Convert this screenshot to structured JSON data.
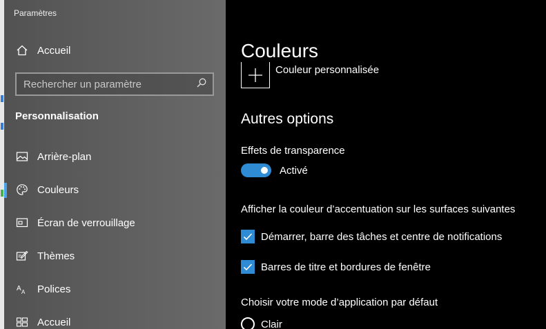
{
  "window": {
    "title": "Paramètres"
  },
  "sidebar": {
    "home_label": "Accueil",
    "search_placeholder": "Rechercher un paramètre",
    "section_title": "Personnalisation",
    "items": [
      {
        "label": "Arrière-plan",
        "icon": "image-icon"
      },
      {
        "label": "Couleurs",
        "icon": "palette-icon",
        "active": true
      },
      {
        "label": "Écran de verrouillage",
        "icon": "lock-screen-icon"
      },
      {
        "label": "Thèmes",
        "icon": "themes-icon"
      },
      {
        "label": "Polices",
        "icon": "font-icon"
      },
      {
        "label": "Accueil",
        "icon": "start-icon"
      }
    ],
    "accent_color": "#4aa3e8"
  },
  "main": {
    "title": "Couleurs",
    "custom_color_label": "Couleur personnalisée",
    "other_options_heading": "Autres options",
    "transparency": {
      "label": "Effets de transparence",
      "state_label": "Activé",
      "on": true
    },
    "accent_surfaces": {
      "label": "Afficher la couleur d’accentuation sur les surfaces suivantes",
      "options": [
        {
          "label": "Démarrer, barre des tâches et centre de notifications",
          "checked": true
        },
        {
          "label": "Barres de titre et bordures de fenêtre",
          "checked": true
        }
      ]
    },
    "app_mode": {
      "label": "Choisir votre mode d’application par défaut",
      "options": [
        {
          "label": "Clair",
          "selected": false
        }
      ]
    },
    "accent_color": "#2f8bd3"
  }
}
